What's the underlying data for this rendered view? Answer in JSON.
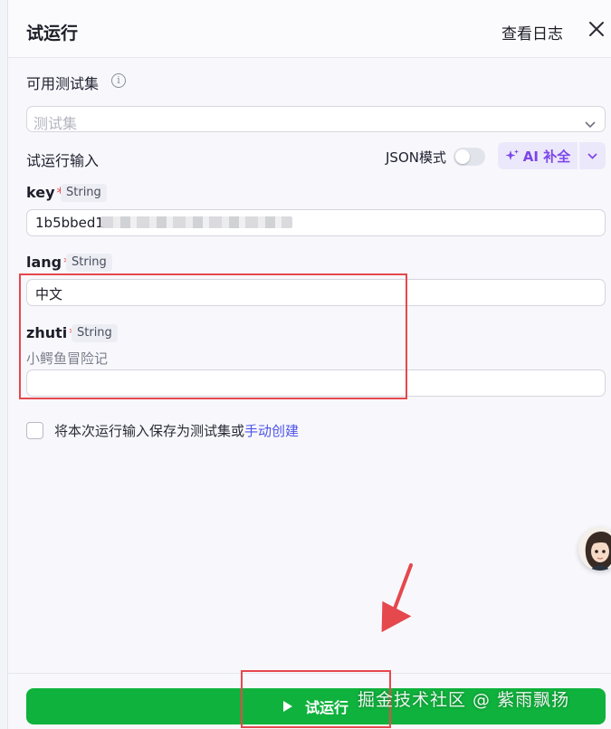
{
  "panel": {
    "title": "试运行",
    "log_link": "查看日志",
    "close_icon": "close-icon"
  },
  "test_set": {
    "label": "可用测试集",
    "info_icon": "info-circle-icon",
    "select_placeholder": "测试集",
    "chevron_icon": "chevron-down-icon"
  },
  "run_input": {
    "label": "试运行输入",
    "json_mode_label": "JSON模式",
    "json_mode_on": false,
    "ai_complete_label": "AI 补全",
    "ai_icon": "sparkle-icon",
    "ai_dropdown_icon": "chevron-down-icon"
  },
  "params": [
    {
      "name": "key",
      "required_mark": "*",
      "type": "String",
      "value": "1b5bbed1",
      "value_obscured": true
    },
    {
      "name": "lang",
      "required_mark": "*",
      "type": "String",
      "value": "中文"
    },
    {
      "name": "zhuti",
      "required_mark": "*",
      "type": "String",
      "description": "小鳄鱼冒险记",
      "value": ""
    }
  ],
  "save": {
    "checked": false,
    "text": "将本次运行输入保存为测试集或",
    "link": "手动创建"
  },
  "footer": {
    "run_label": "试运行",
    "run_icon": "play-icon"
  },
  "watermark": "掘金技术社区 @ 紫雨飘扬",
  "colors": {
    "accent_green": "#0fb23c",
    "ai_purple": "#7b46e8",
    "link_blue": "#4d53e8",
    "annotation_red": "#e5484d",
    "required_red": "#e5484d"
  }
}
